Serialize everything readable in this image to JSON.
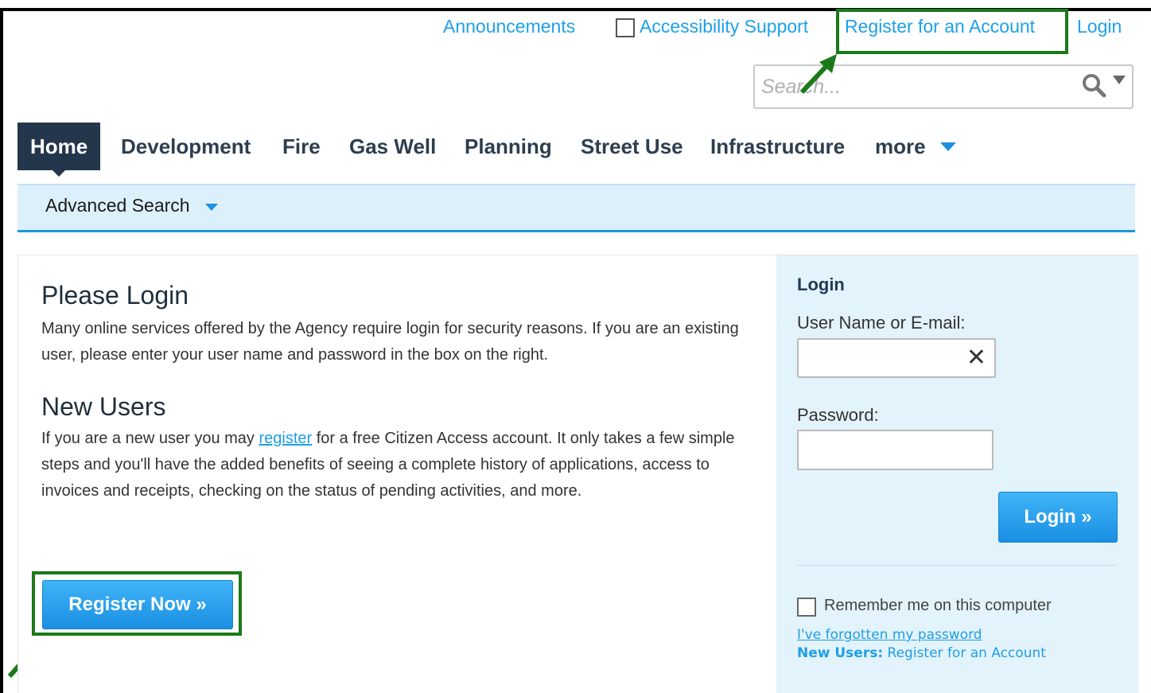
{
  "topbar": {
    "announcements": "Announcements",
    "accessibility": "Accessibility Support",
    "register": "Register for an Account",
    "login": "Login"
  },
  "search": {
    "placeholder": "Search..."
  },
  "nav": {
    "items": [
      "Home",
      "Development",
      "Fire",
      "Gas Well",
      "Planning",
      "Street Use",
      "Infrastructure",
      "more"
    ],
    "active": "Home"
  },
  "subnav": {
    "label": "Advanced Search"
  },
  "main": {
    "please_title": "Please Login",
    "please_text": "Many online services offered by the Agency require login for security reasons. If you are an existing user, please enter your user name and password in the box on the right.",
    "new_title": "New Users",
    "new_text_before": "If you are a new user you may ",
    "new_link": "register",
    "new_text_after": " for a free Citizen Access account. It only takes a few simple steps and you'll have the added benefits of seeing a complete history of applications, access to invoices and receipts, checking on the status of pending activities, and more.",
    "register_button": "Register Now »"
  },
  "login_panel": {
    "title": "Login",
    "user_label": "User Name or E-mail:",
    "user_clear": "✕",
    "password_label": "Password:",
    "login_button": "Login »",
    "remember": "Remember me on this computer",
    "forgot": "I've forgotten my password",
    "new_users_prefix": "New Users:",
    "new_users_link": "Register for an Account"
  },
  "colors": {
    "link": "#1ea1e8",
    "nav_active": "#23364c",
    "highlight": "#1a7a1a",
    "button": "#1b8fe3",
    "panel": "#e3f3fc"
  }
}
